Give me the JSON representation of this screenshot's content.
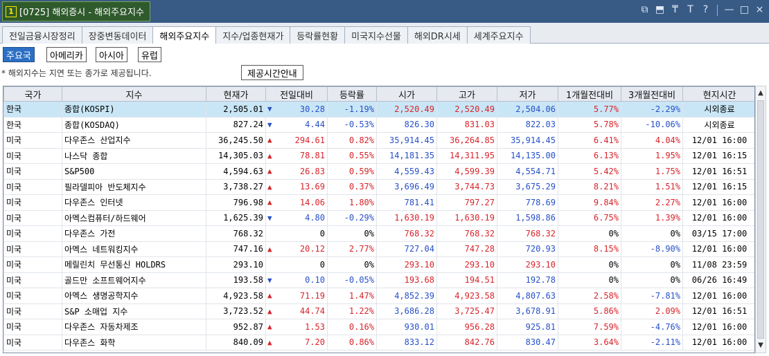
{
  "window": {
    "number_badge": "1",
    "title": "[0725] 해외증시 - 해외주요지수",
    "controls": [
      "⧉",
      "⬒",
      "₸",
      "T",
      "?",
      "—",
      "□",
      "×"
    ]
  },
  "tabs": [
    "전일금융시장정리",
    "장중변동데이터",
    "해외주요지수",
    "지수/업종현재가",
    "등락률현황",
    "미국지수선물",
    "해외DR시세",
    "세계주요지수"
  ],
  "active_tab": 2,
  "subtabs": [
    "주요국",
    "아메리카",
    "아시아",
    "유럽"
  ],
  "active_subtab": 0,
  "notice": "* 해외지수는 지연 또는 종가로 제공됩니다.",
  "info_button": "제공시간안내",
  "columns": [
    "국가",
    "지수",
    "현재가",
    "전일대비",
    "등락률",
    "시가",
    "고가",
    "저가",
    "1개월전대비",
    "3개월전대비",
    "현지시간"
  ],
  "rows": [
    {
      "country": "한국",
      "index": "종합(KOSPI)",
      "price": "2,505.01",
      "dir": "down",
      "change": "30.28",
      "rate": "-1.19%",
      "open": "2,520.49",
      "open_dir": "up",
      "high": "2,520.49",
      "high_dir": "up",
      "low": "2,504.06",
      "low_dir": "down",
      "m1": "5.77%",
      "m1_dir": "up",
      "m3": "-2.29%",
      "m3_dir": "down",
      "time": "시외종료"
    },
    {
      "country": "한국",
      "index": "종합(KOSDAQ)",
      "price": "827.24",
      "dir": "down",
      "change": "4.44",
      "rate": "-0.53%",
      "open": "826.30",
      "open_dir": "down",
      "high": "831.03",
      "high_dir": "up",
      "low": "822.03",
      "low_dir": "down",
      "m1": "5.78%",
      "m1_dir": "up",
      "m3": "-10.06%",
      "m3_dir": "down",
      "time": "시외종료"
    },
    {
      "country": "미국",
      "index": "다우존스 산업지수",
      "price": "36,245.50",
      "dir": "up",
      "change": "294.61",
      "rate": "0.82%",
      "open": "35,914.45",
      "open_dir": "down",
      "high": "36,264.85",
      "high_dir": "up",
      "low": "35,914.45",
      "low_dir": "down",
      "m1": "6.41%",
      "m1_dir": "up",
      "m3": "4.04%",
      "m3_dir": "up",
      "time": "12/01 16:00"
    },
    {
      "country": "미국",
      "index": "나스닥 종합",
      "price": "14,305.03",
      "dir": "up",
      "change": "78.81",
      "rate": "0.55%",
      "open": "14,181.35",
      "open_dir": "down",
      "high": "14,311.95",
      "high_dir": "up",
      "low": "14,135.00",
      "low_dir": "down",
      "m1": "6.13%",
      "m1_dir": "up",
      "m3": "1.95%",
      "m3_dir": "up",
      "time": "12/01 16:15"
    },
    {
      "country": "미국",
      "index": "S&P500",
      "price": "4,594.63",
      "dir": "up",
      "change": "26.83",
      "rate": "0.59%",
      "open": "4,559.43",
      "open_dir": "down",
      "high": "4,599.39",
      "high_dir": "up",
      "low": "4,554.71",
      "low_dir": "down",
      "m1": "5.42%",
      "m1_dir": "up",
      "m3": "1.75%",
      "m3_dir": "up",
      "time": "12/01 16:51"
    },
    {
      "country": "미국",
      "index": "필라델피아 반도체지수",
      "price": "3,738.27",
      "dir": "up",
      "change": "13.69",
      "rate": "0.37%",
      "open": "3,696.49",
      "open_dir": "down",
      "high": "3,744.73",
      "high_dir": "up",
      "low": "3,675.29",
      "low_dir": "down",
      "m1": "8.21%",
      "m1_dir": "up",
      "m3": "1.51%",
      "m3_dir": "up",
      "time": "12/01 16:15"
    },
    {
      "country": "미국",
      "index": "다우존스 인터넷",
      "price": "796.98",
      "dir": "up",
      "change": "14.06",
      "rate": "1.80%",
      "open": "781.41",
      "open_dir": "down",
      "high": "797.27",
      "high_dir": "up",
      "low": "778.69",
      "low_dir": "down",
      "m1": "9.84%",
      "m1_dir": "up",
      "m3": "2.27%",
      "m3_dir": "up",
      "time": "12/01 16:00"
    },
    {
      "country": "미국",
      "index": "아멕스컴퓨터/하드웨어",
      "price": "1,625.39",
      "dir": "down",
      "change": "4.80",
      "rate": "-0.29%",
      "open": "1,630.19",
      "open_dir": "up",
      "high": "1,630.19",
      "high_dir": "up",
      "low": "1,598.86",
      "low_dir": "down",
      "m1": "6.75%",
      "m1_dir": "up",
      "m3": "1.39%",
      "m3_dir": "up",
      "time": "12/01 16:00"
    },
    {
      "country": "미국",
      "index": "다우존스 가전",
      "price": "768.32",
      "dir": "flat",
      "change": "0",
      "rate": "0%",
      "open": "768.32",
      "open_dir": "up",
      "high": "768.32",
      "high_dir": "up",
      "low": "768.32",
      "low_dir": "up",
      "m1": "0%",
      "m1_dir": "flat",
      "m3": "0%",
      "m3_dir": "flat",
      "time": "03/15 17:00"
    },
    {
      "country": "미국",
      "index": "아멕스 네트워킹지수",
      "price": "747.16",
      "dir": "up",
      "change": "20.12",
      "rate": "2.77%",
      "open": "727.04",
      "open_dir": "down",
      "high": "747.28",
      "high_dir": "up",
      "low": "720.93",
      "low_dir": "down",
      "m1": "8.15%",
      "m1_dir": "up",
      "m3": "-8.90%",
      "m3_dir": "down",
      "time": "12/01 16:00"
    },
    {
      "country": "미국",
      "index": "메릴린치 무선통신 HOLDRS",
      "price": "293.10",
      "dir": "flat",
      "change": "0",
      "rate": "0%",
      "open": "293.10",
      "open_dir": "up",
      "high": "293.10",
      "high_dir": "up",
      "low": "293.10",
      "low_dir": "up",
      "m1": "0%",
      "m1_dir": "flat",
      "m3": "0%",
      "m3_dir": "flat",
      "time": "11/08 23:59"
    },
    {
      "country": "미국",
      "index": "골드만 소프트웨어지수",
      "price": "193.58",
      "dir": "down",
      "change": "0.10",
      "rate": "-0.05%",
      "open": "193.68",
      "open_dir": "up",
      "high": "194.51",
      "high_dir": "up",
      "low": "192.78",
      "low_dir": "down",
      "m1": "0%",
      "m1_dir": "flat",
      "m3": "0%",
      "m3_dir": "flat",
      "time": "06/26 16:49"
    },
    {
      "country": "미국",
      "index": "아멕스 생명공학지수",
      "price": "4,923.58",
      "dir": "up",
      "change": "71.19",
      "rate": "1.47%",
      "open": "4,852.39",
      "open_dir": "down",
      "high": "4,923.58",
      "high_dir": "up",
      "low": "4,807.63",
      "low_dir": "down",
      "m1": "2.58%",
      "m1_dir": "up",
      "m3": "-7.81%",
      "m3_dir": "down",
      "time": "12/01 16:00"
    },
    {
      "country": "미국",
      "index": "S&P 소매업 지수",
      "price": "3,723.52",
      "dir": "up",
      "change": "44.74",
      "rate": "1.22%",
      "open": "3,686.28",
      "open_dir": "down",
      "high": "3,725.47",
      "high_dir": "up",
      "low": "3,678.91",
      "low_dir": "down",
      "m1": "5.86%",
      "m1_dir": "up",
      "m3": "2.09%",
      "m3_dir": "up",
      "time": "12/01 16:51"
    },
    {
      "country": "미국",
      "index": "다우존스 자동차제조",
      "price": "952.87",
      "dir": "up",
      "change": "1.53",
      "rate": "0.16%",
      "open": "930.01",
      "open_dir": "down",
      "high": "956.28",
      "high_dir": "up",
      "low": "925.81",
      "low_dir": "down",
      "m1": "7.59%",
      "m1_dir": "up",
      "m3": "-4.76%",
      "m3_dir": "down",
      "time": "12/01 16:00"
    },
    {
      "country": "미국",
      "index": "다우존스 화학",
      "price": "840.09",
      "dir": "up",
      "change": "7.20",
      "rate": "0.86%",
      "open": "833.12",
      "open_dir": "down",
      "high": "842.76",
      "high_dir": "up",
      "low": "830.47",
      "low_dir": "down",
      "m1": "3.64%",
      "m1_dir": "up",
      "m3": "-2.11%",
      "m3_dir": "down",
      "time": "12/01 16:00"
    }
  ],
  "icons": {
    "up_arrow": "▲",
    "down_arrow": "▼",
    "scroll_up": "▲",
    "scroll_down": "▼"
  },
  "colors": {
    "up": "#d8232a",
    "down": "#2650c8",
    "selected_row": "#c9e6f6",
    "title_bar": "#385b86",
    "active_subtab": "#2b6fc4"
  }
}
